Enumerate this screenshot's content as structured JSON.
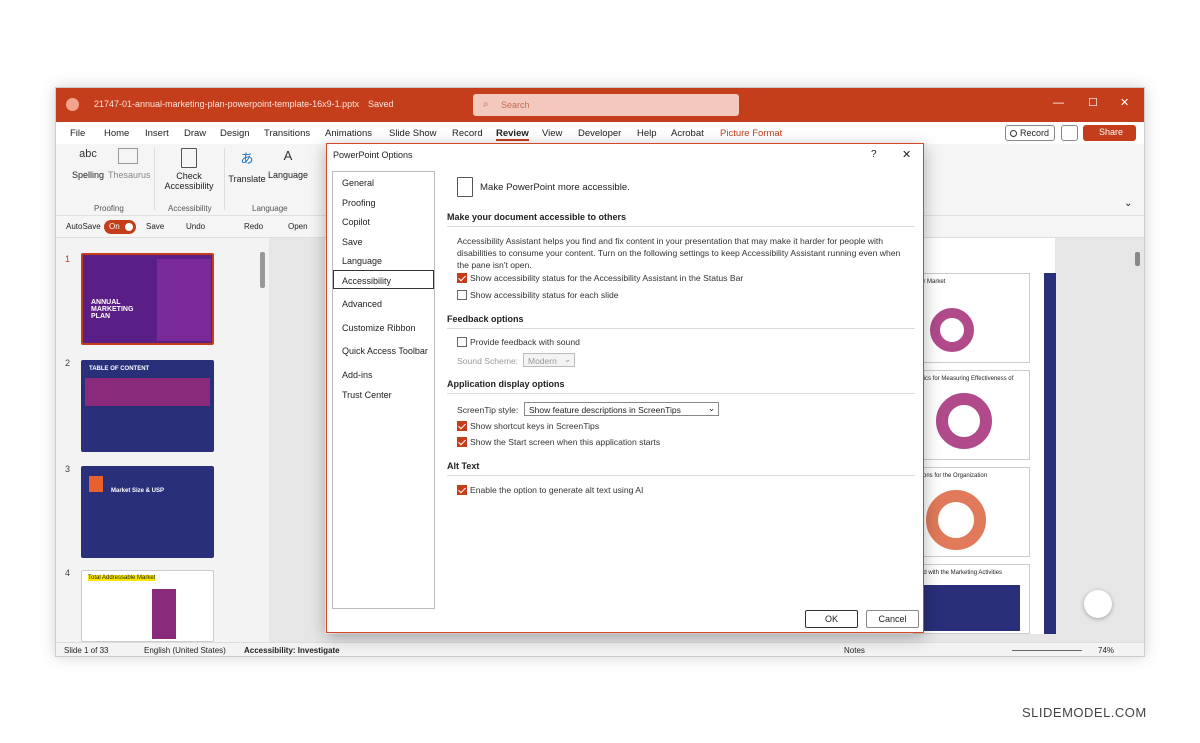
{
  "titlebar": {
    "filename": "21747-01-annual-marketing-plan-powerpoint-template-16x9-1.pptx",
    "saved": "Saved",
    "search_placeholder": "Search"
  },
  "menu": [
    "File",
    "Home",
    "Insert",
    "Draw",
    "Design",
    "Transitions",
    "Animations",
    "Slide Show",
    "Record",
    "Review",
    "View",
    "Developer",
    "Help",
    "Acrobat",
    "Picture Format"
  ],
  "menu_active": "Review",
  "menu_right": {
    "record": "Record",
    "share": "Share"
  },
  "ribbon": {
    "spelling": "Spelling",
    "thesaurus": "Thesaurus",
    "check": "Check",
    "accessibility": "Accessibility",
    "translate": "Translate",
    "language": "Language",
    "group_proofing": "Proofing",
    "group_accessibility": "Accessibility",
    "group_language": "Language"
  },
  "qat": {
    "autosave": "AutoSave",
    "on": "On",
    "save": "Save",
    "undo": "Undo",
    "redo": "Redo",
    "open": "Open"
  },
  "thumbnails": [
    {
      "num": "1",
      "title": "ANNUAL MARKETING PLAN"
    },
    {
      "num": "2",
      "title": "TABLE OF CONTENT"
    },
    {
      "num": "3",
      "title": "Market Size & USP"
    },
    {
      "num": "4",
      "title": "Total Addressable Market"
    }
  ],
  "right_slides": [
    "ur Market",
    "trics for Measuring Effectiveness of",
    "tions for the Organization",
    "ed with the Marketing Activities"
  ],
  "dialog": {
    "title": "PowerPoint Options",
    "help": "?",
    "close": "✕",
    "nav": [
      "General",
      "Proofing",
      "Copilot",
      "Save",
      "Language",
      "Accessibility",
      "Advanced",
      "Customize Ribbon",
      "Quick Access Toolbar",
      "Add-ins",
      "Trust Center"
    ],
    "nav_active": "Accessibility",
    "heading": "Make PowerPoint more accessible.",
    "sec1": "Make your document accessible to others",
    "desc1": "Accessibility Assistant helps you find and fix content in your presentation that may make it harder for people with",
    "desc2": "disabilities to consume your content. Turn on the following settings to keep Accessibility Assistant running even when",
    "desc3": "the pane isn't open.",
    "opt1": "Show accessibility status for the Accessibility Assistant in the Status Bar",
    "opt2": "Show accessibility status for each slide",
    "sec2": "Feedback options",
    "opt3": "Provide feedback with sound",
    "sound_label": "Sound Scheme:",
    "sound_value": "Modern",
    "sec3": "Application display options",
    "screentip_label": "ScreenTip style:",
    "screentip_value": "Show feature descriptions in ScreenTips",
    "opt4": "Show shortcut keys in ScreenTips",
    "opt5": "Show the Start screen when this application starts",
    "sec4": "Alt Text",
    "opt6": "Enable the option to generate alt text using AI",
    "ok": "OK",
    "cancel": "Cancel"
  },
  "status": {
    "slide": "Slide 1 of 33",
    "lang": "English (United States)",
    "access": "Accessibility: Investigate",
    "notes": "Notes",
    "zoom": "74%"
  },
  "watermark": "SLIDEMODEL.COM",
  "colors": {
    "accent": "#c43e1c",
    "navy": "#2a2f7a",
    "purple": "#8a2a7a"
  }
}
